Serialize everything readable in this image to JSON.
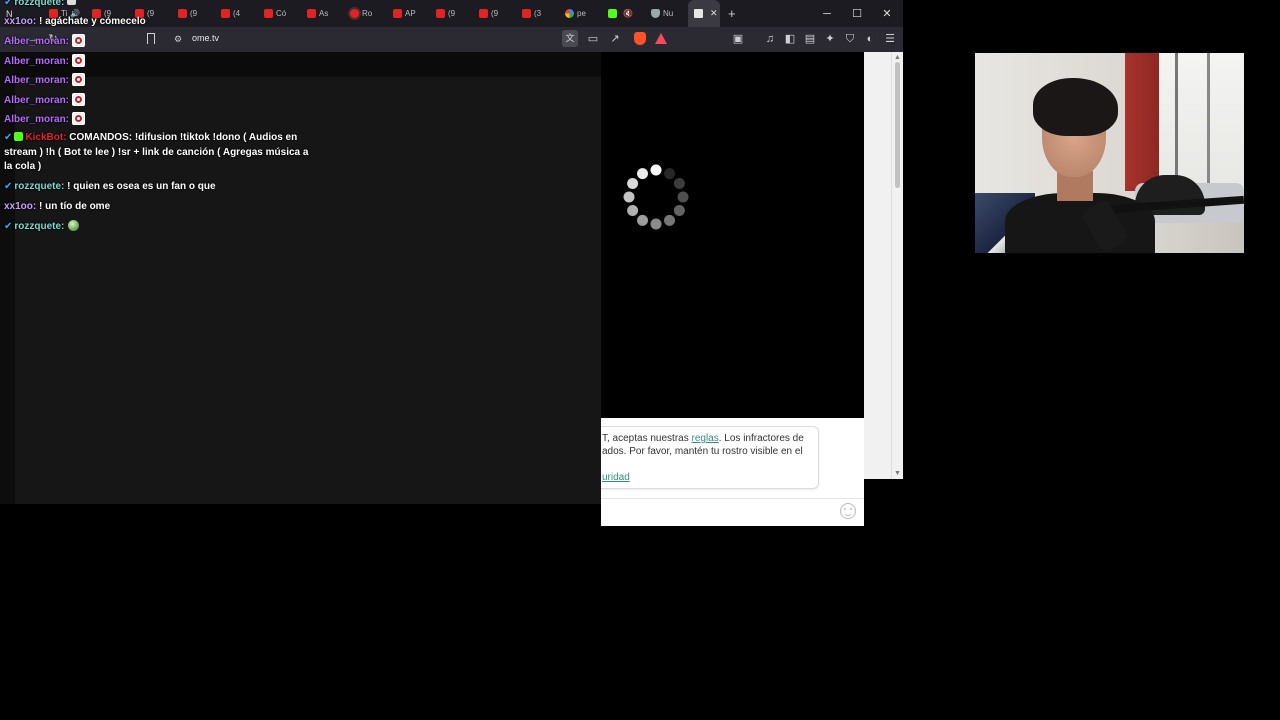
{
  "browser": {
    "tabs": [
      {
        "label": "",
        "icon": "mute-icon"
      },
      {
        "label": "Ti",
        "icon": "tiktok-icon"
      },
      {
        "label": "(9",
        "icon": "youtube-icon"
      },
      {
        "label": "(9",
        "icon": "youtube-icon"
      },
      {
        "label": "(9",
        "icon": "youtube-icon"
      },
      {
        "label": "(4",
        "icon": "youtube-icon"
      },
      {
        "label": "Có",
        "icon": "youtube-icon"
      },
      {
        "label": "As",
        "icon": "youtube-icon"
      },
      {
        "label": "Ro",
        "icon": "record-icon"
      },
      {
        "label": "AP",
        "icon": "youtube-icon"
      },
      {
        "label": "(9",
        "icon": "youtube-icon"
      },
      {
        "label": "(9",
        "icon": "youtube-icon"
      },
      {
        "label": "(3",
        "icon": "youtube-icon"
      },
      {
        "label": "pe",
        "icon": "google-icon"
      },
      {
        "label": "",
        "icon": "kick-icon"
      },
      {
        "label": "Nu",
        "icon": "shield-icon"
      },
      {
        "label": "",
        "icon": "ome-icon"
      }
    ],
    "active_tab_close": "✕",
    "new_tab": "+",
    "window_controls": {
      "minimize": "─",
      "maximize": "☐",
      "close": "✕"
    },
    "url": "ome.tv"
  },
  "chat": {
    "messages": [
      {
        "user": "rozzquete:",
        "text": "",
        "user_color": "#7fd6d0",
        "verified": true
      },
      {
        "user": "xx1oo:",
        "text": "! agáchate y cómecelo",
        "user_color": "#c9a0ff"
      },
      {
        "user": "Alber_moran:",
        "text": "",
        "user_color": "#b46bff",
        "emote": "record-emote"
      },
      {
        "user": "Alber_moran:",
        "text": "",
        "user_color": "#b46bff",
        "emote": "record-emote"
      },
      {
        "user": "Alber_moran:",
        "text": "",
        "user_color": "#b46bff",
        "emote": "record-emote"
      },
      {
        "user": "Alber_moran:",
        "text": "",
        "user_color": "#b46bff",
        "emote": "record-emote"
      },
      {
        "user": "Alber_moran:",
        "text": "",
        "user_color": "#b46bff",
        "emote": "record-emote"
      },
      {
        "user": "KickBot:",
        "text": "COMANDOS: !difusion !tiktok !dono ( Audios en stream ) !h ( Bot te lee ) !sr + link de canción ( Agregas música a la cola )",
        "user_color": "#e0242f",
        "verified": true
      },
      {
        "user": "rozzquete:",
        "text": "! quien es osea es un fan o que",
        "user_color": "#7fd6d0",
        "verified": true
      },
      {
        "user": "xx1oo:",
        "text": "! un tío de ome",
        "user_color": "#c9a0ff"
      },
      {
        "user": "rozzquete:",
        "text": "",
        "user_color": "#7fd6d0",
        "verified": true,
        "emote": "ball-emote"
      }
    ]
  },
  "ome": {
    "notice_part1": "T, aceptas nuestras ",
    "notice_link1": "reglas",
    "notice_part2": ". Los infractores de",
    "notice_line2": "ados. Por favor, mantén tu rostro visible en el",
    "notice_link2": "uridad"
  },
  "colors": {
    "chrome_bg": "#1c1b22",
    "toolbar_bg": "#2b2a33",
    "chat_bg": "#161616",
    "link": "#2f8f7a",
    "kick_green": "#53fc18"
  }
}
